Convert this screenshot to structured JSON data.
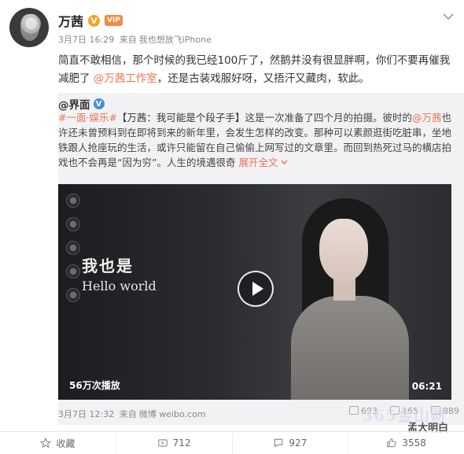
{
  "author": {
    "name": "万茜",
    "verified_badge": "V",
    "vip_badge": "VIP",
    "date": "3月7日",
    "time": "16:29",
    "source_prefix": "来自",
    "source": "我也想放飞iPhone"
  },
  "post": {
    "text_1": "简直不敢相信，那个时候的我已经100斤了，然鹅并没有很显胖啊，你们不要再催我减肥了",
    "mention": "@万茜工作室",
    "text_2": "，还是古装戏服好呀，又捂汗又藏肉，软此。"
  },
  "repost": {
    "author": "@界面",
    "verified_badge": "V",
    "tag": "#一面·娱乐#",
    "title": "【万茜：我可能是个段子手】",
    "text_1": "这是一次准备了四个月的拍摄。彼时的",
    "mention": "@万茜",
    "text_2": "也许还未曾预料到在即将到来的新年里，会发生怎样的改变。那种可以素颜逛街吃脏串，坐地铁跟人抢座玩的生活，或许只能留在自己偷偷上网写过的文章里。而回到热死过马的横店拍戏也不会再是“因为穷”。人生的境遇很奇",
    "expand": "展开全文",
    "expand_icon": "chevron-down-icon",
    "video": {
      "title_cn": "我也是",
      "title_en": "Hello world",
      "plays": "56万次播放",
      "duration": "06:21"
    },
    "date": "3月7日",
    "time": "12:32",
    "source_prefix": "来自",
    "source": "微博 weibo.com",
    "repost_count": "693",
    "comment_count": "165",
    "like_count": "889"
  },
  "actions": {
    "favorite": "收藏",
    "repost": "712",
    "comment": "927",
    "like": "3558"
  },
  "watermark": {
    "text": "365金山财",
    "subtext": "孟大明白"
  },
  "colors": {
    "mention": "#eb7350",
    "verified_orange": "#f7a21b",
    "verified_blue": "#3f93e0",
    "repost_bg": "#f2f2f5"
  }
}
